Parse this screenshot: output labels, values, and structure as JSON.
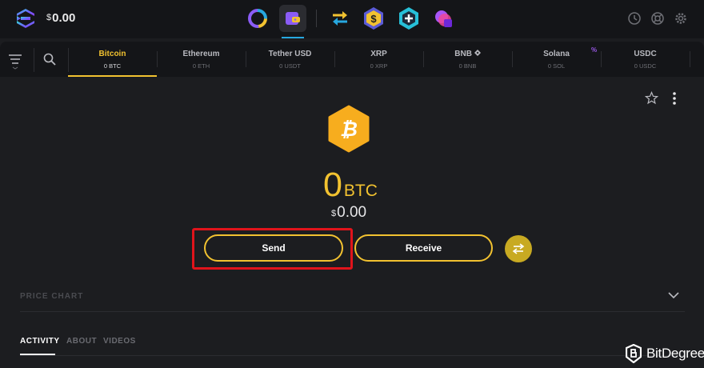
{
  "topbar": {
    "balance_currency": "$",
    "balance_value": "0.00",
    "apps": [
      {
        "icon": "portfolio-ring-icon"
      },
      {
        "icon": "wallet-icon",
        "active": true
      },
      {
        "icon": "exchange-arrows-icon"
      },
      {
        "icon": "dollar-hex-icon"
      },
      {
        "icon": "plus-hex-icon"
      },
      {
        "icon": "purple-blob-icon"
      }
    ],
    "right_icons": [
      "history-icon",
      "support-icon",
      "settings-icon"
    ]
  },
  "assetbar": {
    "tabs": [
      {
        "name": "Bitcoin",
        "amount": "0 BTC",
        "active": true
      },
      {
        "name": "Ethereum",
        "amount": "0 ETH"
      },
      {
        "name": "Tether USD",
        "amount": "0 USDT"
      },
      {
        "name": "XRP",
        "amount": "0 XRP"
      },
      {
        "name": "BNB",
        "amount": "0 BNB"
      },
      {
        "name": "Solana",
        "amount": "0 SOL"
      },
      {
        "name": "USDC",
        "amount": "0 USDC"
      }
    ],
    "solana_badge": "%"
  },
  "coin": {
    "icon": "bitcoin-icon",
    "amount": "0",
    "unit": "BTC",
    "fiat_currency": "$",
    "fiat_value": "0.00"
  },
  "actions": {
    "send_label": "Send",
    "receive_label": "Receive"
  },
  "sections": {
    "price_chart": "PRICE CHART",
    "tabs": [
      "ACTIVITY",
      "ABOUT",
      "VIDEOS"
    ]
  },
  "watermark": {
    "text": "BitDegree"
  },
  "colors": {
    "accent": "#f2c230",
    "highlight": "#e0141b",
    "background": "#1c1d20",
    "bar": "#141518"
  }
}
